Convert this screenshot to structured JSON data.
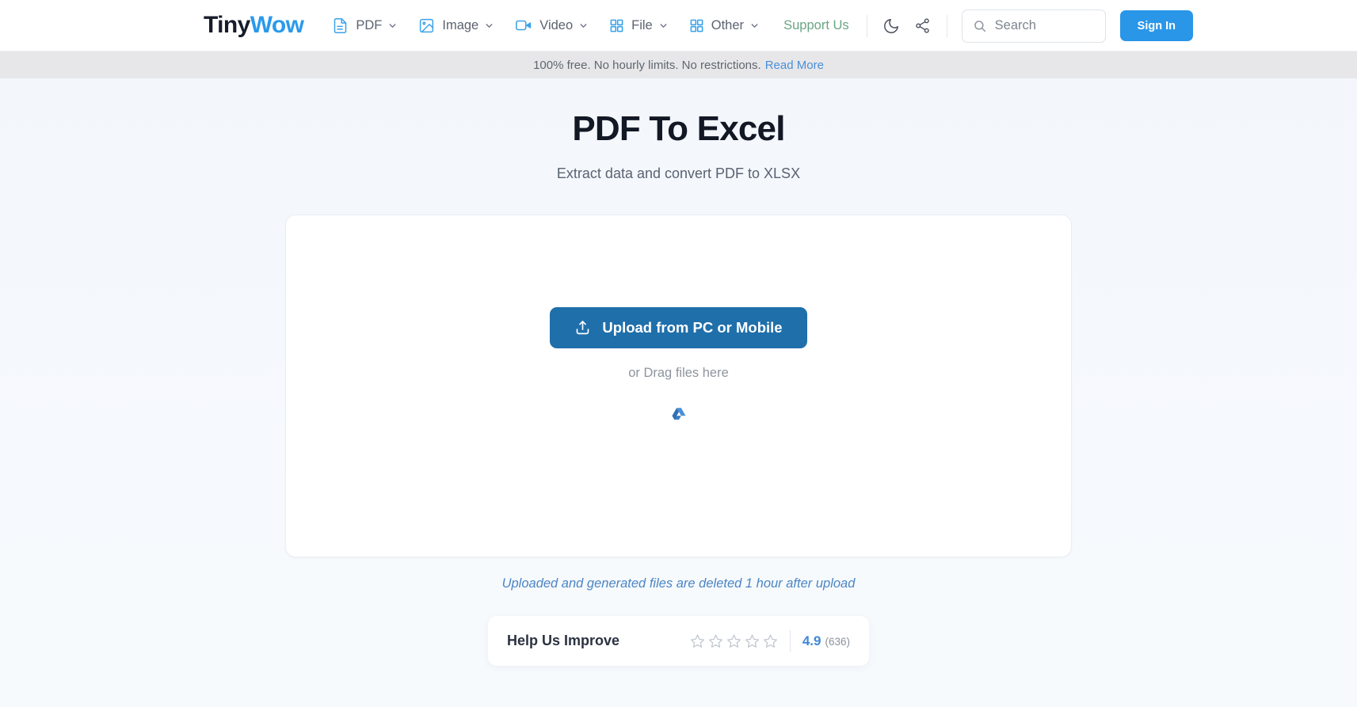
{
  "header": {
    "logo": {
      "part1": "Tiny",
      "part2": "Wow"
    },
    "nav": [
      {
        "label": "PDF",
        "icon": "document-icon",
        "chevron": "chevron-down-icon"
      },
      {
        "label": "Image",
        "icon": "image-icon",
        "chevron": "chevron-down-icon"
      },
      {
        "label": "Video",
        "icon": "video-icon",
        "chevron": "chevron-down-icon"
      },
      {
        "label": "File",
        "icon": "grid-icon",
        "chevron": "chevron-down-icon"
      },
      {
        "label": "Other",
        "icon": "grid-icon",
        "chevron": "chevron-down-icon"
      }
    ],
    "support_us": "Support Us",
    "dark_mode_icon": "moon-icon",
    "share_icon": "share-icon",
    "search": {
      "placeholder": "Search",
      "value": "",
      "icon": "search-icon"
    },
    "sign_in": "Sign In",
    "colors": {
      "logo_accent": "#2a9aeb",
      "signin_bg": "#2a96e8",
      "support_us": "#6aa584"
    }
  },
  "notice": {
    "text": "100% free. No hourly limits. No restrictions.",
    "link": "Read More",
    "link_color": "#4a8fd8",
    "bg": "#e7e7e9"
  },
  "main": {
    "title": "PDF To Excel",
    "subtitle": "Extract data and convert PDF to XLSX",
    "dropzone": {
      "upload_button": "Upload from PC or Mobile",
      "upload_icon": "upload-icon",
      "drag_text": "or Drag files here",
      "drive_icon": "google-drive-icon",
      "button_bg": "#1f6fab"
    },
    "delete_note": "Uploaded and generated files are deleted 1 hour after upload",
    "delete_note_color": "#4c85c4"
  },
  "rating": {
    "title": "Help Us Improve",
    "stars_total": 5,
    "stars_filled": 0,
    "score": "4.9",
    "count": "(636)",
    "score_color": "#3d87d8"
  }
}
